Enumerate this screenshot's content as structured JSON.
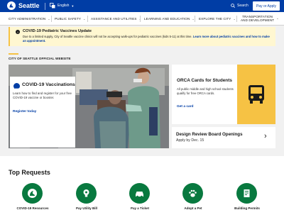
{
  "header": {
    "logo_text": "Seattle",
    "language": "English",
    "search_label": "Search",
    "pay_label": "Pay or Apply"
  },
  "nav": {
    "items": [
      {
        "label": "CITY ADMINISTRATION"
      },
      {
        "label": "PUBLIC SAFETY"
      },
      {
        "label": "ASSISTANCE AND UTILITIES"
      },
      {
        "label": "LEARNING AND EDUCATION"
      },
      {
        "label": "EXPLORE THE CITY"
      },
      {
        "label_line1": "TRANSPORTATION",
        "label_line2": "AND DEVELOPMENT"
      }
    ]
  },
  "alert": {
    "title": "COVID-19 Pediatric Vaccines Update",
    "body": "Due to a limited supply, City of Seattle vaccine clinics will not be accepting walk-ups for pediatric vaccines (kids 5-11) at this time.",
    "link": "Learn more about pediatric vaccines and how to make an appointment."
  },
  "official_label": "CITY OF SEATTLE OFFICIAL WEBSITE",
  "covid_card": {
    "title": "COVID-19 Vaccinations",
    "body": "Learn how to find and register for your free COVID-19 vaccine or booster.",
    "link": "Register today"
  },
  "orca_card": {
    "title": "ORCA Cards for Students",
    "body": "All public middle and high school students qualify for free ORCA cards.",
    "link": "Get a card",
    "icon": "bus-icon"
  },
  "design_card": {
    "title": "Design Review Board Openings",
    "subtitle": "Apply by Dec. 15"
  },
  "top_requests": {
    "title": "Top Requests",
    "items": [
      {
        "label": "COVID-19 Resources",
        "icon": "seattle-logo-icon"
      },
      {
        "label": "Pay Utility Bill",
        "icon": "lightbulb-icon"
      },
      {
        "label": "Pay a Ticket",
        "icon": "car-icon"
      },
      {
        "label": "Adopt a Pet",
        "icon": "paw-icon"
      },
      {
        "label": "Building Permits",
        "icon": "permit-icon"
      }
    ]
  },
  "colors": {
    "brand_blue": "#003da5",
    "gold": "#f6c244",
    "green": "#08793f",
    "alert_bg": "#fff7d1"
  }
}
